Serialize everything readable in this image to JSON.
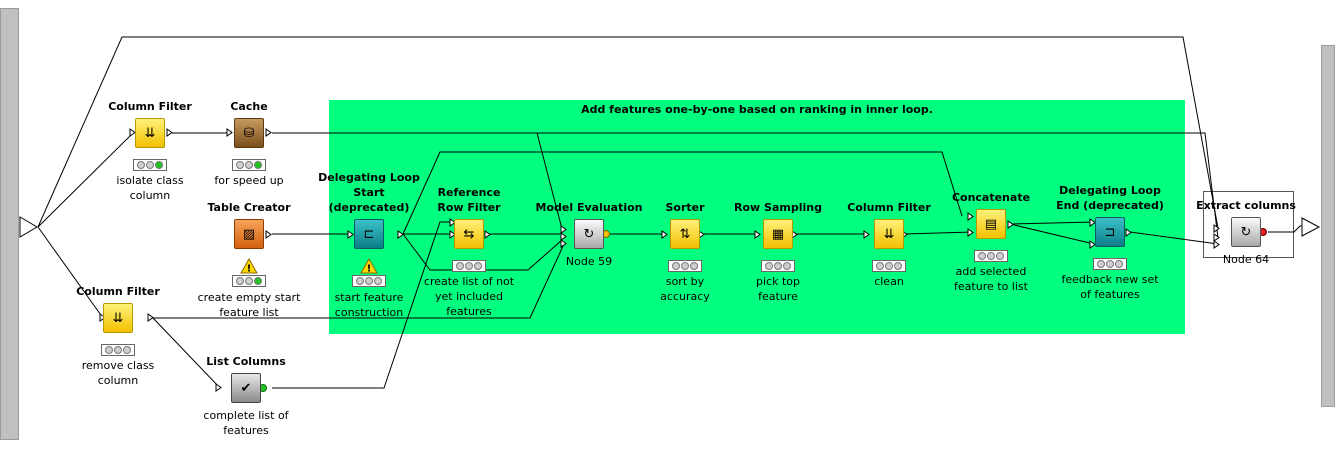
{
  "annotation": {
    "text": "Add features one-by-one based on ranking in inner loop."
  },
  "colors": {
    "annotation": "#00ff7f",
    "green": "#22c322",
    "yellow": "#f2d200",
    "red": "#e02020",
    "off": "#cfcfcf"
  },
  "nodes": [
    {
      "id": "n_cf1",
      "title": "Column Filter",
      "label": "isolate class column",
      "icon": "column-filter-icon",
      "kind": "yellow",
      "glyph": "⇊",
      "state": "green",
      "warn": false
    },
    {
      "id": "n_cache",
      "title": "Cache",
      "label": "for speed up",
      "icon": "cache-icon",
      "kind": "brown",
      "glyph": "⛁",
      "state": "green",
      "warn": false
    },
    {
      "id": "n_tc",
      "title": "Table Creator",
      "label": "create empty start feature list",
      "icon": "table-creator-icon",
      "kind": "orange",
      "glyph": "▨",
      "state": "green",
      "warn": true
    },
    {
      "id": "n_cf2",
      "title": "Column Filter",
      "label": "remove class column",
      "icon": "column-filter-icon",
      "kind": "yellow",
      "glyph": "⇊",
      "state": "off",
      "warn": false
    },
    {
      "id": "n_lc",
      "title": "List Columns",
      "label": "complete list of features",
      "icon": "list-columns-icon",
      "kind": "gray2",
      "glyph": "✔",
      "state": "none",
      "warn": false
    },
    {
      "id": "n_dls",
      "title": "Delegating Loop Start (deprecated)",
      "label": "start feature construction",
      "icon": "loop-start-icon",
      "kind": "teal",
      "glyph": "⊏",
      "state": "off",
      "warn": true
    },
    {
      "id": "n_rrf",
      "title": "Reference Row Filter",
      "label": "create list of not yet included features",
      "icon": "reference-row-filter-icon",
      "kind": "yellow",
      "glyph": "⇆",
      "state": "off",
      "warn": false
    },
    {
      "id": "n_me",
      "title": "Model Evaluation",
      "label": "Node 59",
      "icon": "model-evaluation-icon",
      "kind": "gray",
      "glyph": "↻",
      "state": "none",
      "warn": false
    },
    {
      "id": "n_sort",
      "title": "Sorter",
      "label": "sort by accuracy",
      "icon": "sorter-icon",
      "kind": "yellow",
      "glyph": "⇅",
      "state": "off",
      "warn": false
    },
    {
      "id": "n_rs",
      "title": "Row Sampling",
      "label": "pick top feature",
      "icon": "row-sampling-icon",
      "kind": "yellow",
      "glyph": "▦",
      "state": "off",
      "warn": false
    },
    {
      "id": "n_cf3",
      "title": "Column Filter",
      "label": "clean",
      "icon": "column-filter-icon",
      "kind": "yellow",
      "glyph": "⇊",
      "state": "off",
      "warn": false
    },
    {
      "id": "n_conc",
      "title": "Concatenate",
      "label": "add selected feature to list",
      "icon": "concatenate-icon",
      "kind": "yellow",
      "glyph": "▤",
      "state": "off",
      "warn": false
    },
    {
      "id": "n_dle",
      "title": "Delegating Loop End (deprecated)",
      "label": "feedback new set of features",
      "icon": "loop-end-icon",
      "kind": "teal",
      "glyph": "⊐",
      "state": "off",
      "warn": false
    },
    {
      "id": "n_ec",
      "title": "Extract columns",
      "label": "Node 64",
      "icon": "extract-columns-icon",
      "kind": "gray",
      "glyph": "↻",
      "state": "none",
      "warn": false
    }
  ]
}
